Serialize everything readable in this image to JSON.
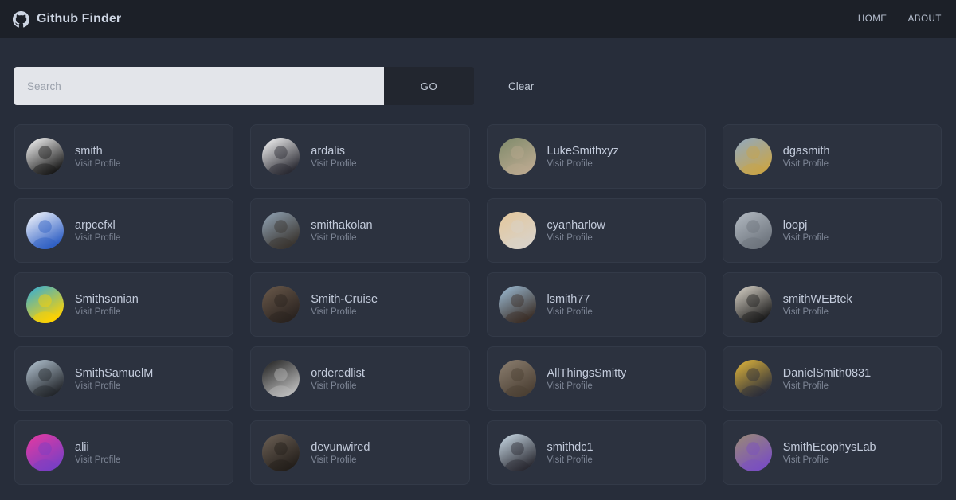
{
  "navbar": {
    "brand_icon": "github-icon",
    "brand_title": "Github Finder",
    "links": [
      {
        "label": "HOME",
        "name": "nav-link-home"
      },
      {
        "label": "ABOUT",
        "name": "nav-link-about"
      }
    ]
  },
  "search": {
    "placeholder": "Search",
    "value": "",
    "go_label": "GO",
    "clear_label": "Clear"
  },
  "colors": {
    "page_background": "#272d3a",
    "navbar_background": "#1c2028",
    "card_background": "#2c323f",
    "card_border": "#333a48",
    "input_background": "#e3e5ea",
    "go_button_background": "#22262f",
    "username_text": "#c3cbdb",
    "muted_text": "#7d8595"
  },
  "users": [
    {
      "username": "smith",
      "action": "Visit Profile",
      "avatar": "tcb-lightning-logo",
      "avatar_colors": [
        "#ffffff",
        "#1b1b1b"
      ]
    },
    {
      "username": "ardalis",
      "action": "Visit Profile",
      "avatar": "cartoon-man-portrait",
      "avatar_colors": [
        "#ffffff",
        "#2b2b33"
      ]
    },
    {
      "username": "LukeSmithxyz",
      "action": "Visit Profile",
      "avatar": "bearded-man-photo",
      "avatar_colors": [
        "#7e8a6a",
        "#b9a88f"
      ]
    },
    {
      "username": "dgasmith",
      "action": "Visit Profile",
      "avatar": "landscape-photo",
      "avatar_colors": [
        "#8fa9c4",
        "#c8a54a"
      ]
    },
    {
      "username": "arpcefxl",
      "action": "Visit Profile",
      "avatar": "man-blue-background-photo",
      "avatar_colors": [
        "#ffffff",
        "#2f5fc4"
      ]
    },
    {
      "username": "smithakolan",
      "action": "Visit Profile",
      "avatar": "woman-dark-hair-photo",
      "avatar_colors": [
        "#93a6b8",
        "#3a3530"
      ]
    },
    {
      "username": "cyanharlow",
      "action": "Visit Profile",
      "avatar": "woman-glasses-photo",
      "avatar_colors": [
        "#e4c79b",
        "#d9d2c8"
      ]
    },
    {
      "username": "loopj",
      "action": "Visit Profile",
      "avatar": "man-suit-photo",
      "avatar_colors": [
        "#b5bcc4",
        "#6d747d"
      ]
    },
    {
      "username": "Smithsonian",
      "action": "Visit Profile",
      "avatar": "sunburst-logo",
      "avatar_colors": [
        "#29abe2",
        "#ffd200"
      ]
    },
    {
      "username": "Smith-Cruise",
      "action": "Visit Profile",
      "avatar": "man-sunglasses-photo",
      "avatar_colors": [
        "#6b5a4b",
        "#2a2320"
      ]
    },
    {
      "username": "lsmith77",
      "action": "Visit Profile",
      "avatar": "bearded-man-snow-photo",
      "avatar_colors": [
        "#9fc0da",
        "#3b2f28"
      ]
    },
    {
      "username": "smithWEBtek",
      "action": "Visit Profile",
      "avatar": "bald-man-photo",
      "avatar_colors": [
        "#ded8cd",
        "#1d1d1d"
      ]
    },
    {
      "username": "SmithSamuelM",
      "action": "Visit Profile",
      "avatar": "man-mountains-photo",
      "avatar_colors": [
        "#b7c8d6",
        "#24272c"
      ]
    },
    {
      "username": "orderedlist",
      "action": "Visit Profile",
      "avatar": "man-glasses-bw-photo",
      "avatar_colors": [
        "#1a1a1a",
        "#b9b9b9"
      ]
    },
    {
      "username": "AllThingsSmitty",
      "action": "Visit Profile",
      "avatar": "man-cap-photo",
      "avatar_colors": [
        "#8d8071",
        "#4c4034"
      ]
    },
    {
      "username": "DanielSmith0831",
      "action": "Visit Profile",
      "avatar": "man-yellow-background-photo",
      "avatar_colors": [
        "#e5b93b",
        "#2d2f3a"
      ]
    },
    {
      "username": "alii",
      "action": "Visit Profile",
      "avatar": "pink-purple-portrait",
      "avatar_colors": [
        "#e8399f",
        "#7b3fc4"
      ]
    },
    {
      "username": "devunwired",
      "action": "Visit Profile",
      "avatar": "man-beard-sepia-photo",
      "avatar_colors": [
        "#6e6257",
        "#241f1b"
      ]
    },
    {
      "username": "smithdc1",
      "action": "Visit Profile",
      "avatar": "person-snow-landscape-photo",
      "avatar_colors": [
        "#cfe0ec",
        "#2b2b33"
      ]
    },
    {
      "username": "SmithEcophysLab",
      "action": "Visit Profile",
      "avatar": "purple-flower-photo",
      "avatar_colors": [
        "#9a8b73",
        "#7a4fc0"
      ]
    }
  ]
}
